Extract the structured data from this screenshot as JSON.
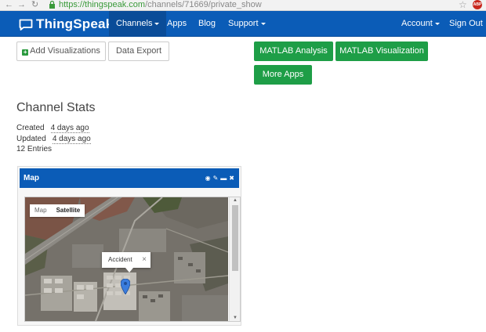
{
  "browser": {
    "url_domain": "https://thingspeak.com",
    "url_path": "/channels/71669/private_show"
  },
  "navbar": {
    "brand": "ThingSpeak",
    "channels": "Channels",
    "apps": "Apps",
    "blog": "Blog",
    "support": "Support",
    "account": "Account",
    "sign_out": "Sign Out"
  },
  "actions": {
    "add_visualizations": "Add Visualizations",
    "data_export": "Data Export",
    "matlab_analysis": "MATLAB Analysis",
    "matlab_visualization": "MATLAB Visualization",
    "more_apps": "More Apps"
  },
  "stats": {
    "title": "Channel Stats",
    "created_label": "Created",
    "created_value": "4 days ago",
    "updated_label": "Updated",
    "updated_value": "4 days ago",
    "entries": "12 Entries"
  },
  "widget": {
    "title": "Map",
    "map_type_map": "Map",
    "map_type_satellite": "Satellite",
    "popup_label": "Accident"
  },
  "colors": {
    "navbar": "#0b5cb7",
    "green_button": "#1e9e47",
    "marker": "#3b7ddd"
  }
}
